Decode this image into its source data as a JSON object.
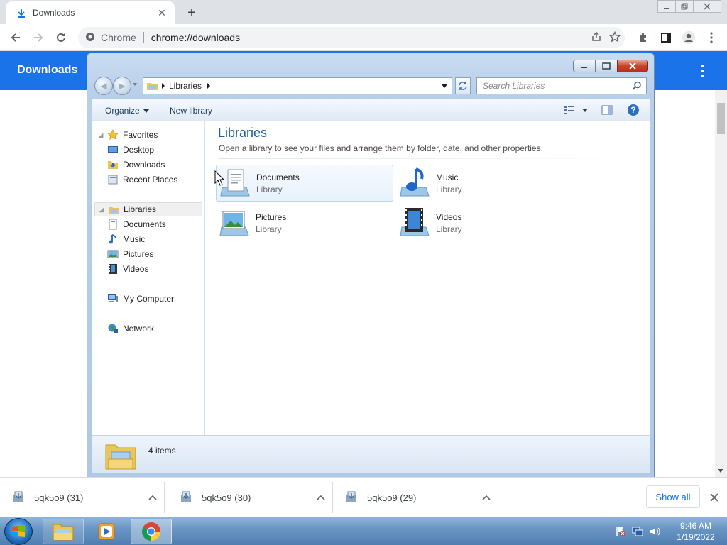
{
  "browser": {
    "tab_title": "Downloads",
    "omnibox_scheme_label": "Chrome",
    "omnibox_url": "chrome://downloads"
  },
  "downloads_page": {
    "title": "Downloads"
  },
  "explorer": {
    "address_crumb": "Libraries",
    "search_placeholder": "Search Libraries",
    "commands": {
      "organize": "Organize",
      "new_library": "New library"
    },
    "nav": {
      "favorites": "Favorites",
      "desktop": "Desktop",
      "downloads": "Downloads",
      "recent_places": "Recent Places",
      "libraries": "Libraries",
      "documents": "Documents",
      "music": "Music",
      "pictures": "Pictures",
      "videos": "Videos",
      "my_computer": "My Computer",
      "network": "Network"
    },
    "content": {
      "title": "Libraries",
      "subtitle": "Open a library to see your files and arrange them by folder, date, and other properties.",
      "libraries": [
        {
          "name": "Documents",
          "type": "Library"
        },
        {
          "name": "Music",
          "type": "Library"
        },
        {
          "name": "Pictures",
          "type": "Library"
        },
        {
          "name": "Videos",
          "type": "Library"
        }
      ]
    },
    "details": {
      "item_count": "4 items"
    }
  },
  "shelf": {
    "items": [
      {
        "name": "5qk5o9 (31)"
      },
      {
        "name": "5qk5o9 (30)"
      },
      {
        "name": "5qk5o9 (29)"
      }
    ],
    "show_all": "Show all"
  },
  "taskbar": {
    "time": "9:46 AM",
    "date": "1/19/2022"
  },
  "colors": {
    "chrome_blue": "#1a73e8",
    "explorer_title_green": "#1e5e9d"
  }
}
